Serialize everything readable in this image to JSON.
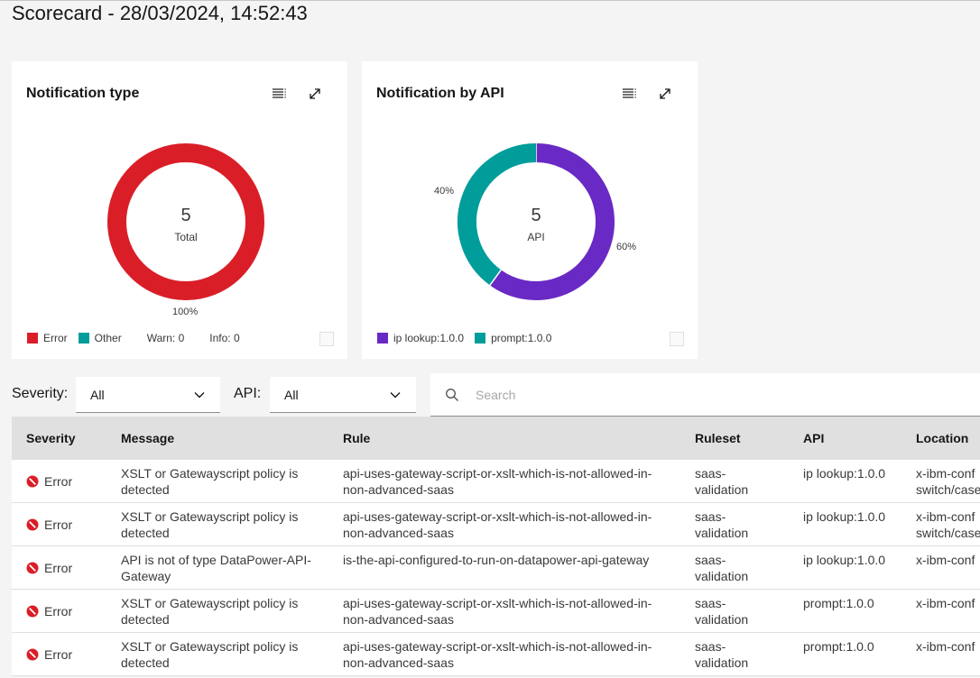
{
  "page": {
    "title": "Scorecard - 28/03/2024, 14:52:43"
  },
  "colors": {
    "error": "#da1e28",
    "other": "#009d9a",
    "purple": "#6929c4",
    "teal": "#009d9a"
  },
  "cards": [
    {
      "title": "Notification type",
      "center_value": "5",
      "center_label": "Total",
      "legend": [
        "Error",
        "Other",
        "Warn: 0",
        "Info: 0"
      ]
    },
    {
      "title": "Notification by API",
      "center_value": "5",
      "center_label": "API",
      "legend": [
        "ip lookup:1.0.0",
        "prompt:1.0.0"
      ]
    }
  ],
  "chart_data": [
    {
      "type": "pie",
      "categories": [
        "Error"
      ],
      "values": [
        100
      ],
      "labels": [
        "100%"
      ]
    },
    {
      "type": "pie",
      "categories": [
        "ip lookup:1.0.0",
        "prompt:1.0.0"
      ],
      "values": [
        60,
        40
      ],
      "labels": [
        "60%",
        "40%"
      ]
    }
  ],
  "filters": {
    "severity_label": "Severity:",
    "severity_value": "All",
    "api_label": "API:",
    "api_value": "All",
    "search_placeholder": "Search"
  },
  "table": {
    "headers": [
      "Severity",
      "Message",
      "Rule",
      "Ruleset",
      "API",
      "Location"
    ],
    "rows": [
      [
        "Error",
        "XSLT or Gatewayscript policy is detected",
        "api-uses-gateway-script-or-xslt-which-is-not-allowed-in-non-advanced-saas",
        "saas-validation",
        "ip lookup:1.0.0",
        "x-ibm-conf switch/case"
      ],
      [
        "Error",
        "XSLT or Gatewayscript policy is detected",
        "api-uses-gateway-script-or-xslt-which-is-not-allowed-in-non-advanced-saas",
        "saas-validation",
        "ip lookup:1.0.0",
        "x-ibm-conf switch/case"
      ],
      [
        "Error",
        "API is not of type DataPower-API-Gateway",
        "is-the-api-configured-to-run-on-datapower-api-gateway",
        "saas-validation",
        "ip lookup:1.0.0",
        "x-ibm-conf"
      ],
      [
        "Error",
        "XSLT or Gatewayscript policy is detected",
        "api-uses-gateway-script-or-xslt-which-is-not-allowed-in-non-advanced-saas",
        "saas-validation",
        "prompt:1.0.0",
        "x-ibm-conf"
      ],
      [
        "Error",
        "XSLT or Gatewayscript policy is detected",
        "api-uses-gateway-script-or-xslt-which-is-not-allowed-in-non-advanced-saas",
        "saas-validation",
        "prompt:1.0.0",
        "x-ibm-conf"
      ]
    ]
  }
}
